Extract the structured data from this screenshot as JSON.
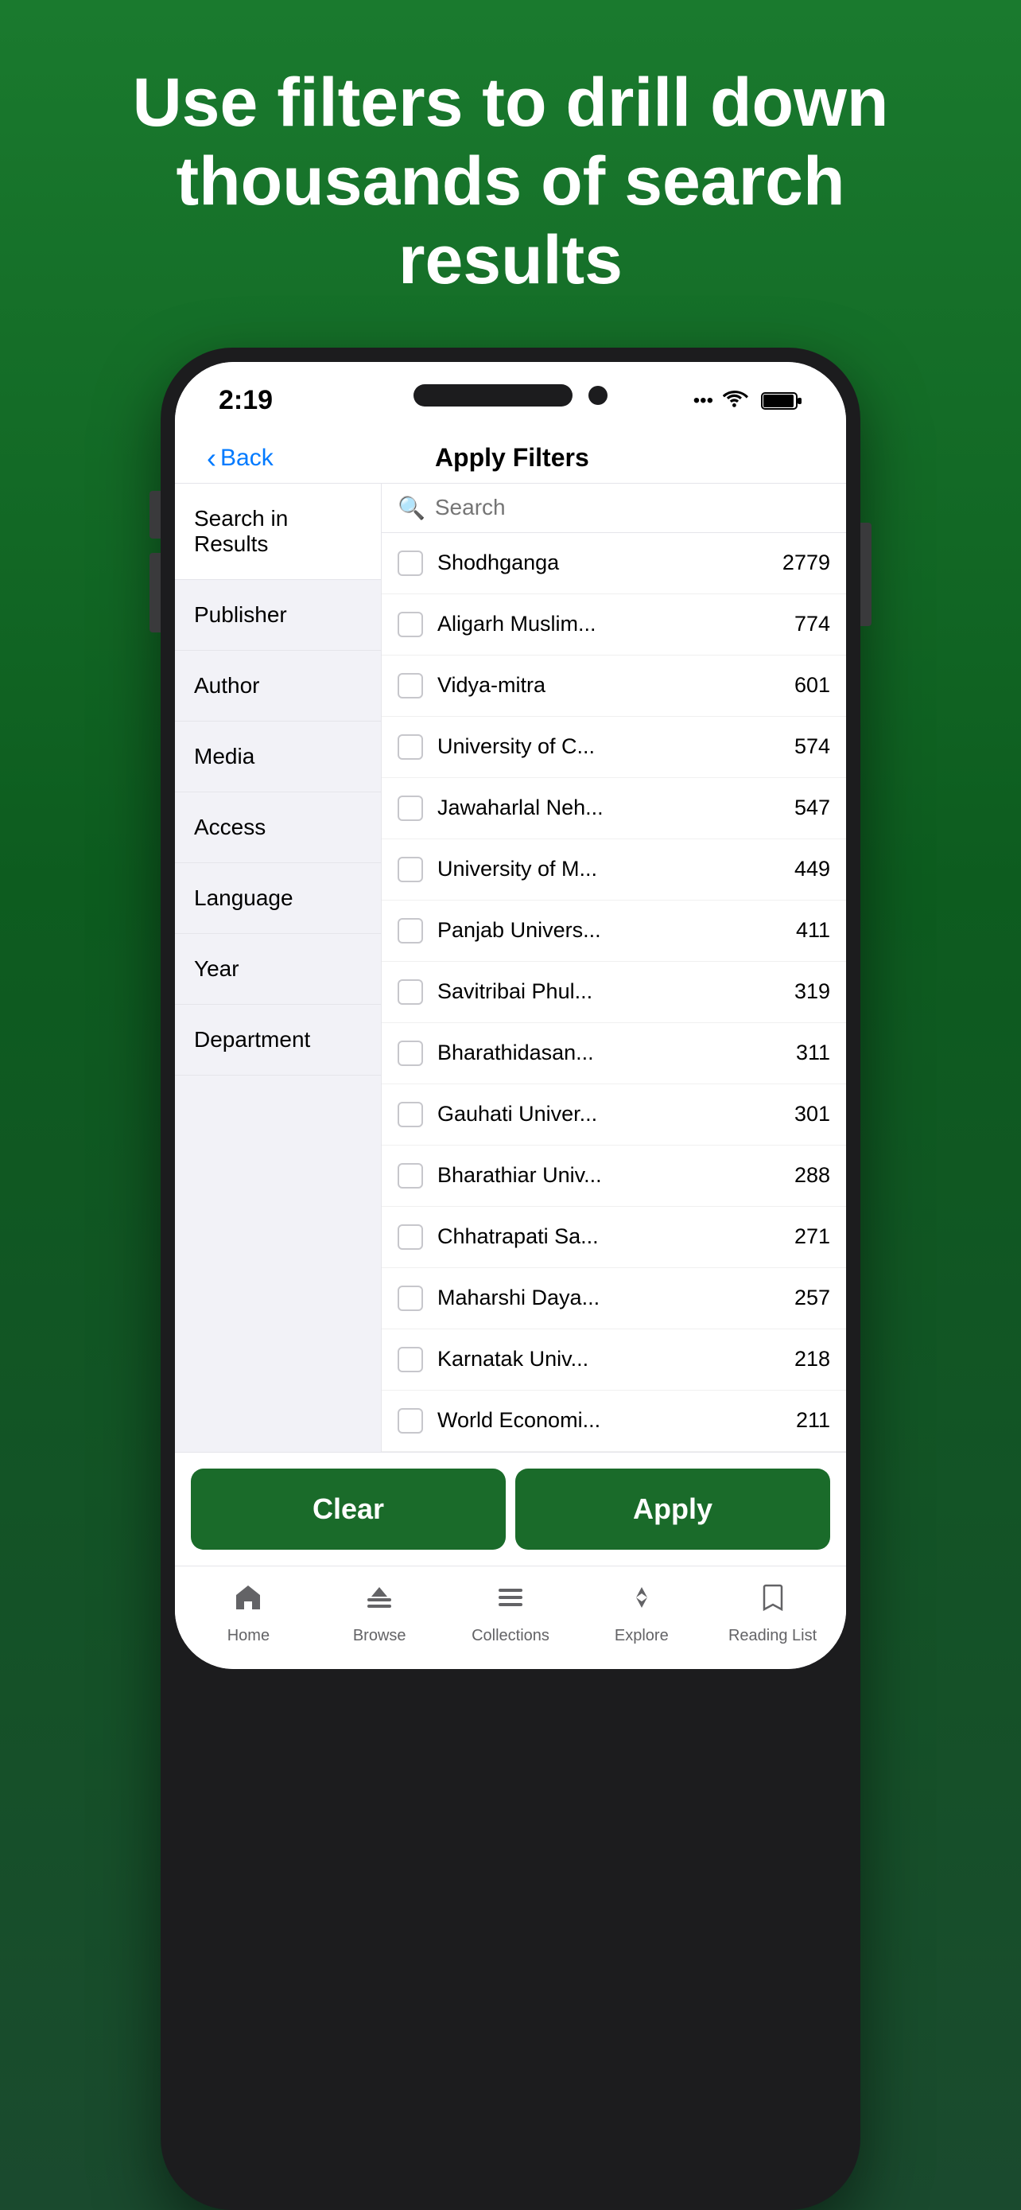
{
  "hero": {
    "text": "Use filters to drill down thousands of search results"
  },
  "status_bar": {
    "time": "2:19",
    "signal": "...",
    "wifi": "wifi",
    "battery": "battery"
  },
  "nav": {
    "back_label": "Back",
    "title": "Apply Filters"
  },
  "search": {
    "placeholder": "Search"
  },
  "filter_categories": [
    {
      "label": "Search in Results",
      "active": true
    },
    {
      "label": "Publisher",
      "active": false
    },
    {
      "label": "Author",
      "active": false
    },
    {
      "label": "Media",
      "active": false
    },
    {
      "label": "Access",
      "active": false
    },
    {
      "label": "Language",
      "active": false
    },
    {
      "label": "Year",
      "active": false
    },
    {
      "label": "Department",
      "active": false
    }
  ],
  "results": [
    {
      "name": "Shodhganga",
      "count": "2779"
    },
    {
      "name": "Aligarh Muslim...",
      "count": "774"
    },
    {
      "name": "Vidya-mitra",
      "count": "601"
    },
    {
      "name": "University of C...",
      "count": "574"
    },
    {
      "name": "Jawaharlal Neh...",
      "count": "547"
    },
    {
      "name": "University of M...",
      "count": "449"
    },
    {
      "name": "Panjab Univers...",
      "count": "411"
    },
    {
      "name": "Savitribai Phul...",
      "count": "319"
    },
    {
      "name": "Bharathidasan...",
      "count": "311"
    },
    {
      "name": "Gauhati Univer...",
      "count": "301"
    },
    {
      "name": "Bharathiar Univ...",
      "count": "288"
    },
    {
      "name": "Chhatrapati Sa...",
      "count": "271"
    },
    {
      "name": "Maharshi Daya...",
      "count": "257"
    },
    {
      "name": "Karnatak Univ...",
      "count": "218"
    },
    {
      "name": "World Economi...",
      "count": "211"
    }
  ],
  "buttons": {
    "clear": "Clear",
    "apply": "Apply"
  },
  "tab_bar": {
    "items": [
      {
        "label": "Home",
        "icon": "🏠"
      },
      {
        "label": "Browse",
        "icon": "⬆"
      },
      {
        "label": "Collections",
        "icon": "☰"
      },
      {
        "label": "Explore",
        "icon": "◆"
      },
      {
        "label": "Reading List",
        "icon": "🔖"
      }
    ]
  }
}
